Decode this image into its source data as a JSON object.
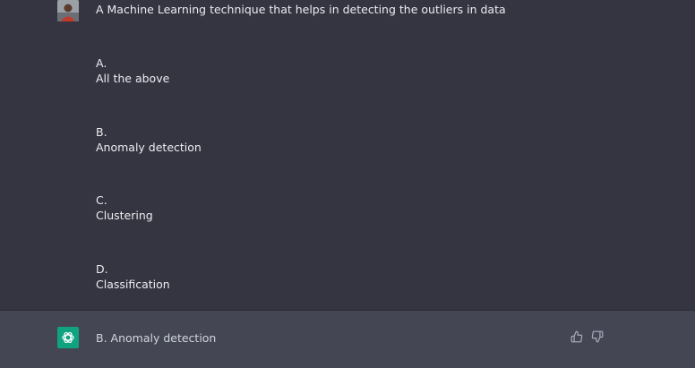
{
  "conversation": {
    "user_message": {
      "avatar_icon": "user-avatar",
      "question": "A Machine Learning technique that helps in detecting the outliers in data",
      "options": [
        {
          "letter": "A.",
          "text": "All the above"
        },
        {
          "letter": "B.",
          "text": "Anomaly detection"
        },
        {
          "letter": "C.",
          "text": "Clustering"
        },
        {
          "letter": "D.",
          "text": "Classification"
        }
      ]
    },
    "assistant_message": {
      "avatar_icon": "openai-logo-icon",
      "answer": "B. Anomaly detection",
      "feedback": {
        "thumbs_up_icon": "thumbs-up-icon",
        "thumbs_down_icon": "thumbs-down-icon"
      }
    }
  },
  "colors": {
    "background": "#343541",
    "assistant_background": "#444654",
    "text": "#ececf1",
    "brand": "#10a37f"
  }
}
